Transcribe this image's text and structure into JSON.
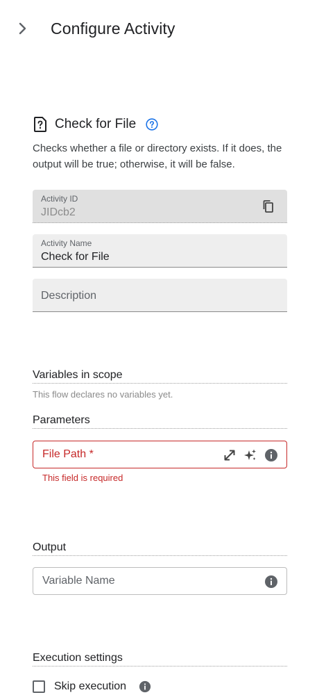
{
  "header": {
    "title": "Configure Activity",
    "collapse_icon": "chevron-right-icon"
  },
  "activity": {
    "icon": "file-question-icon",
    "title": "Check for File",
    "help_icon": "help-circle-icon",
    "description": "Checks whether a file or directory exists. If it does, the output will be true; otherwise, it will be false."
  },
  "fields": {
    "activity_id": {
      "label": "Activity ID",
      "value": "JIDcb2",
      "icon": "copy-icon"
    },
    "activity_name": {
      "label": "Activity Name",
      "value": "Check for File"
    },
    "description": {
      "placeholder": "Description"
    }
  },
  "variables": {
    "heading": "Variables in scope",
    "empty_text": "This flow declares no variables yet."
  },
  "parameters": {
    "heading": "Parameters",
    "file_path": {
      "label": "File Path *",
      "error": "This field is required",
      "icons": [
        "expand-icon",
        "sparkle-icon",
        "info-icon"
      ]
    }
  },
  "output": {
    "heading": "Output",
    "variable_name": {
      "placeholder": "Variable Name",
      "icon": "info-icon"
    }
  },
  "execution": {
    "heading": "Execution settings",
    "skip_label": "Skip execution",
    "skip_checked": false,
    "icon": "info-icon"
  },
  "colors": {
    "error": "#c62828",
    "accent": "#1a73e8",
    "field_bg": "#eeeeee"
  }
}
